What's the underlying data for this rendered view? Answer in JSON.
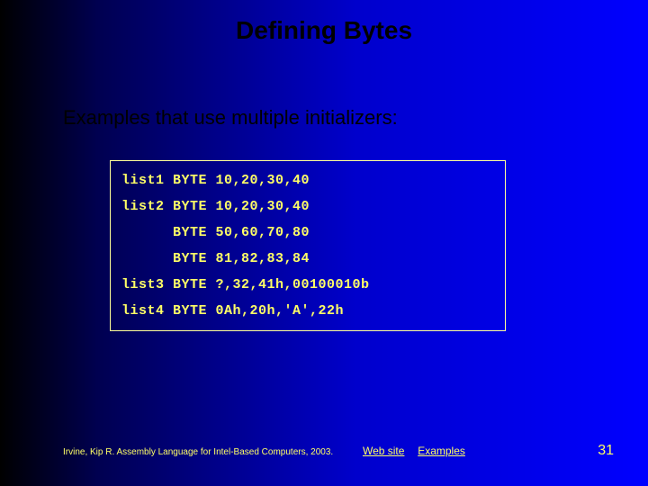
{
  "title": "Defining Bytes",
  "subtitle": "Examples that use multiple initializers:",
  "code": {
    "lines": [
      "list1 BYTE 10,20,30,40",
      "list2 BYTE 10,20,30,40",
      "      BYTE 50,60,70,80",
      "      BYTE 81,82,83,84",
      "list3 BYTE ?,32,41h,00100010b",
      "list4 BYTE 0Ah,20h,'A',22h"
    ]
  },
  "footer": {
    "credit": "Irvine, Kip R. Assembly Language for Intel-Based Computers, 2003.",
    "links": {
      "website": "Web site",
      "examples": "Examples"
    }
  },
  "page_number": "31"
}
